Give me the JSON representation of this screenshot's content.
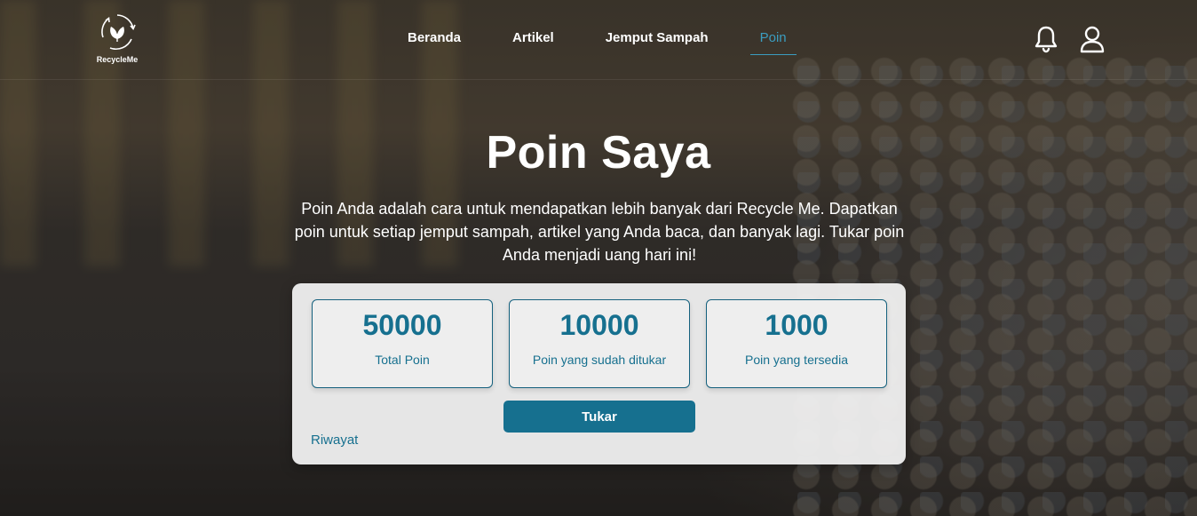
{
  "brand": {
    "name": "RecycleMe",
    "logo_icon": "recycle-leaf-icon"
  },
  "nav": {
    "items": [
      {
        "label": "Beranda"
      },
      {
        "label": "Artikel"
      },
      {
        "label": "Jemput Sampah"
      },
      {
        "label": "Poin",
        "active": true
      }
    ],
    "notification_icon": "bell-icon",
    "profile_icon": "user-icon"
  },
  "hero": {
    "title": "Poin Saya",
    "description": "Poin Anda adalah cara untuk mendapatkan lebih banyak dari Recycle Me. Dapatkan poin untuk setiap jemput sampah, artikel yang Anda baca, dan banyak lagi. Tukar poin Anda menjadi uang hari ini!"
  },
  "points": {
    "stats": [
      {
        "value": "50000",
        "label": "Total Poin"
      },
      {
        "value": "10000",
        "label": "Poin yang sudah ditukar"
      },
      {
        "value": "1000",
        "label": "Poin yang tersedia"
      }
    ],
    "redeem_label": "Tukar",
    "history_label": "Riwayat"
  },
  "colors": {
    "accent": "#16708f",
    "nav_active": "#3b9dc0",
    "card_bg": "#f2f2f2"
  }
}
